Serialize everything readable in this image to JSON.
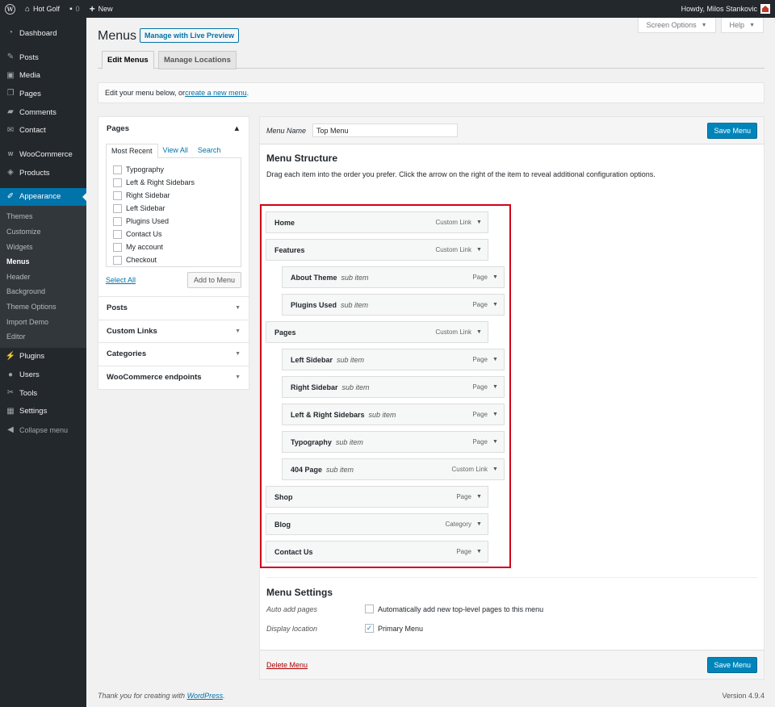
{
  "adminbar": {
    "site": "Hot Golf",
    "comments_count": "0",
    "new_label": "New",
    "howdy": "Howdy, Milos Stankovic"
  },
  "sidebar": {
    "items": [
      {
        "label": "Dashboard",
        "icon": "dashboard-icon"
      },
      {
        "label": "Posts",
        "icon": "pin-icon"
      },
      {
        "label": "Media",
        "icon": "media-icon"
      },
      {
        "label": "Pages",
        "icon": "pages-icon"
      },
      {
        "label": "Comments",
        "icon": "comment-icon"
      },
      {
        "label": "Contact",
        "icon": "mail-icon"
      },
      {
        "label": "WooCommerce",
        "icon": "woocommerce-icon"
      },
      {
        "label": "Products",
        "icon": "box-icon"
      },
      {
        "label": "Appearance",
        "icon": "brush-icon"
      },
      {
        "label": "Plugins",
        "icon": "plug-icon"
      },
      {
        "label": "Users",
        "icon": "user-icon"
      },
      {
        "label": "Tools",
        "icon": "wrench-icon"
      },
      {
        "label": "Settings",
        "icon": "settings-icon"
      }
    ],
    "appearance_sub": [
      "Themes",
      "Customize",
      "Widgets",
      "Menus",
      "Header",
      "Background",
      "Theme Options",
      "Import Demo",
      "Editor"
    ],
    "collapse": "Collapse menu"
  },
  "screen_options": "Screen Options",
  "help": "Help",
  "page": {
    "title": "Menus",
    "live_preview": "Manage with Live Preview",
    "tab_edit": "Edit Menus",
    "tab_locations": "Manage Locations",
    "notice_prefix": "Edit your menu below, or ",
    "notice_link": "create a new menu",
    "notice_suffix": "."
  },
  "left": {
    "pages_title": "Pages",
    "tabs": [
      "Most Recent",
      "View All",
      "Search"
    ],
    "page_items": [
      "Typography",
      "Left & Right Sidebars",
      "Right Sidebar",
      "Left Sidebar",
      "Plugins Used",
      "Contact Us",
      "My account",
      "Checkout"
    ],
    "select_all": "Select All",
    "add_to_menu": "Add to Menu",
    "sections": [
      "Posts",
      "Custom Links",
      "Categories",
      "WooCommerce endpoints"
    ]
  },
  "right": {
    "menu_name_label": "Menu Name",
    "menu_name_value": "Top Menu",
    "save": "Save Menu",
    "structure_title": "Menu Structure",
    "structure_desc": "Drag each item into the order you prefer. Click the arrow on the right of the item to reveal additional configuration options.",
    "items": [
      {
        "title": "Home",
        "sub": "",
        "type": "Custom Link",
        "depth": 0
      },
      {
        "title": "Features",
        "sub": "",
        "type": "Custom Link",
        "depth": 0
      },
      {
        "title": "About Theme",
        "sub": "sub item",
        "type": "Page",
        "depth": 1
      },
      {
        "title": "Plugins Used",
        "sub": "sub item",
        "type": "Page",
        "depth": 1
      },
      {
        "title": "Pages",
        "sub": "",
        "type": "Custom Link",
        "depth": 0
      },
      {
        "title": "Left Sidebar",
        "sub": "sub item",
        "type": "Page",
        "depth": 1
      },
      {
        "title": "Right Sidebar",
        "sub": "sub item",
        "type": "Page",
        "depth": 1
      },
      {
        "title": "Left & Right Sidebars",
        "sub": "sub item",
        "type": "Page",
        "depth": 1
      },
      {
        "title": "Typography",
        "sub": "sub item",
        "type": "Page",
        "depth": 1
      },
      {
        "title": "404 Page",
        "sub": "sub item",
        "type": "Custom Link",
        "depth": 1
      },
      {
        "title": "Shop",
        "sub": "",
        "type": "Page",
        "depth": 0
      },
      {
        "title": "Blog",
        "sub": "",
        "type": "Category",
        "depth": 0
      },
      {
        "title": "Contact Us",
        "sub": "",
        "type": "Page",
        "depth": 0
      }
    ],
    "settings_title": "Menu Settings",
    "auto_add_label": "Auto add pages",
    "auto_add_text": "Automatically add new top-level pages to this menu",
    "display_location_label": "Display location",
    "primary_menu": "Primary Menu",
    "primary_checked": true,
    "delete_menu": "Delete Menu"
  },
  "footer": {
    "thanks_prefix": "Thank you for creating with ",
    "thanks_link": "WordPress",
    "thanks_suffix": ".",
    "version": "Version 4.9.4"
  },
  "colors": {
    "admin_dark": "#23282d",
    "accent": "#0073aa",
    "highlight_box": "#d0021b"
  }
}
